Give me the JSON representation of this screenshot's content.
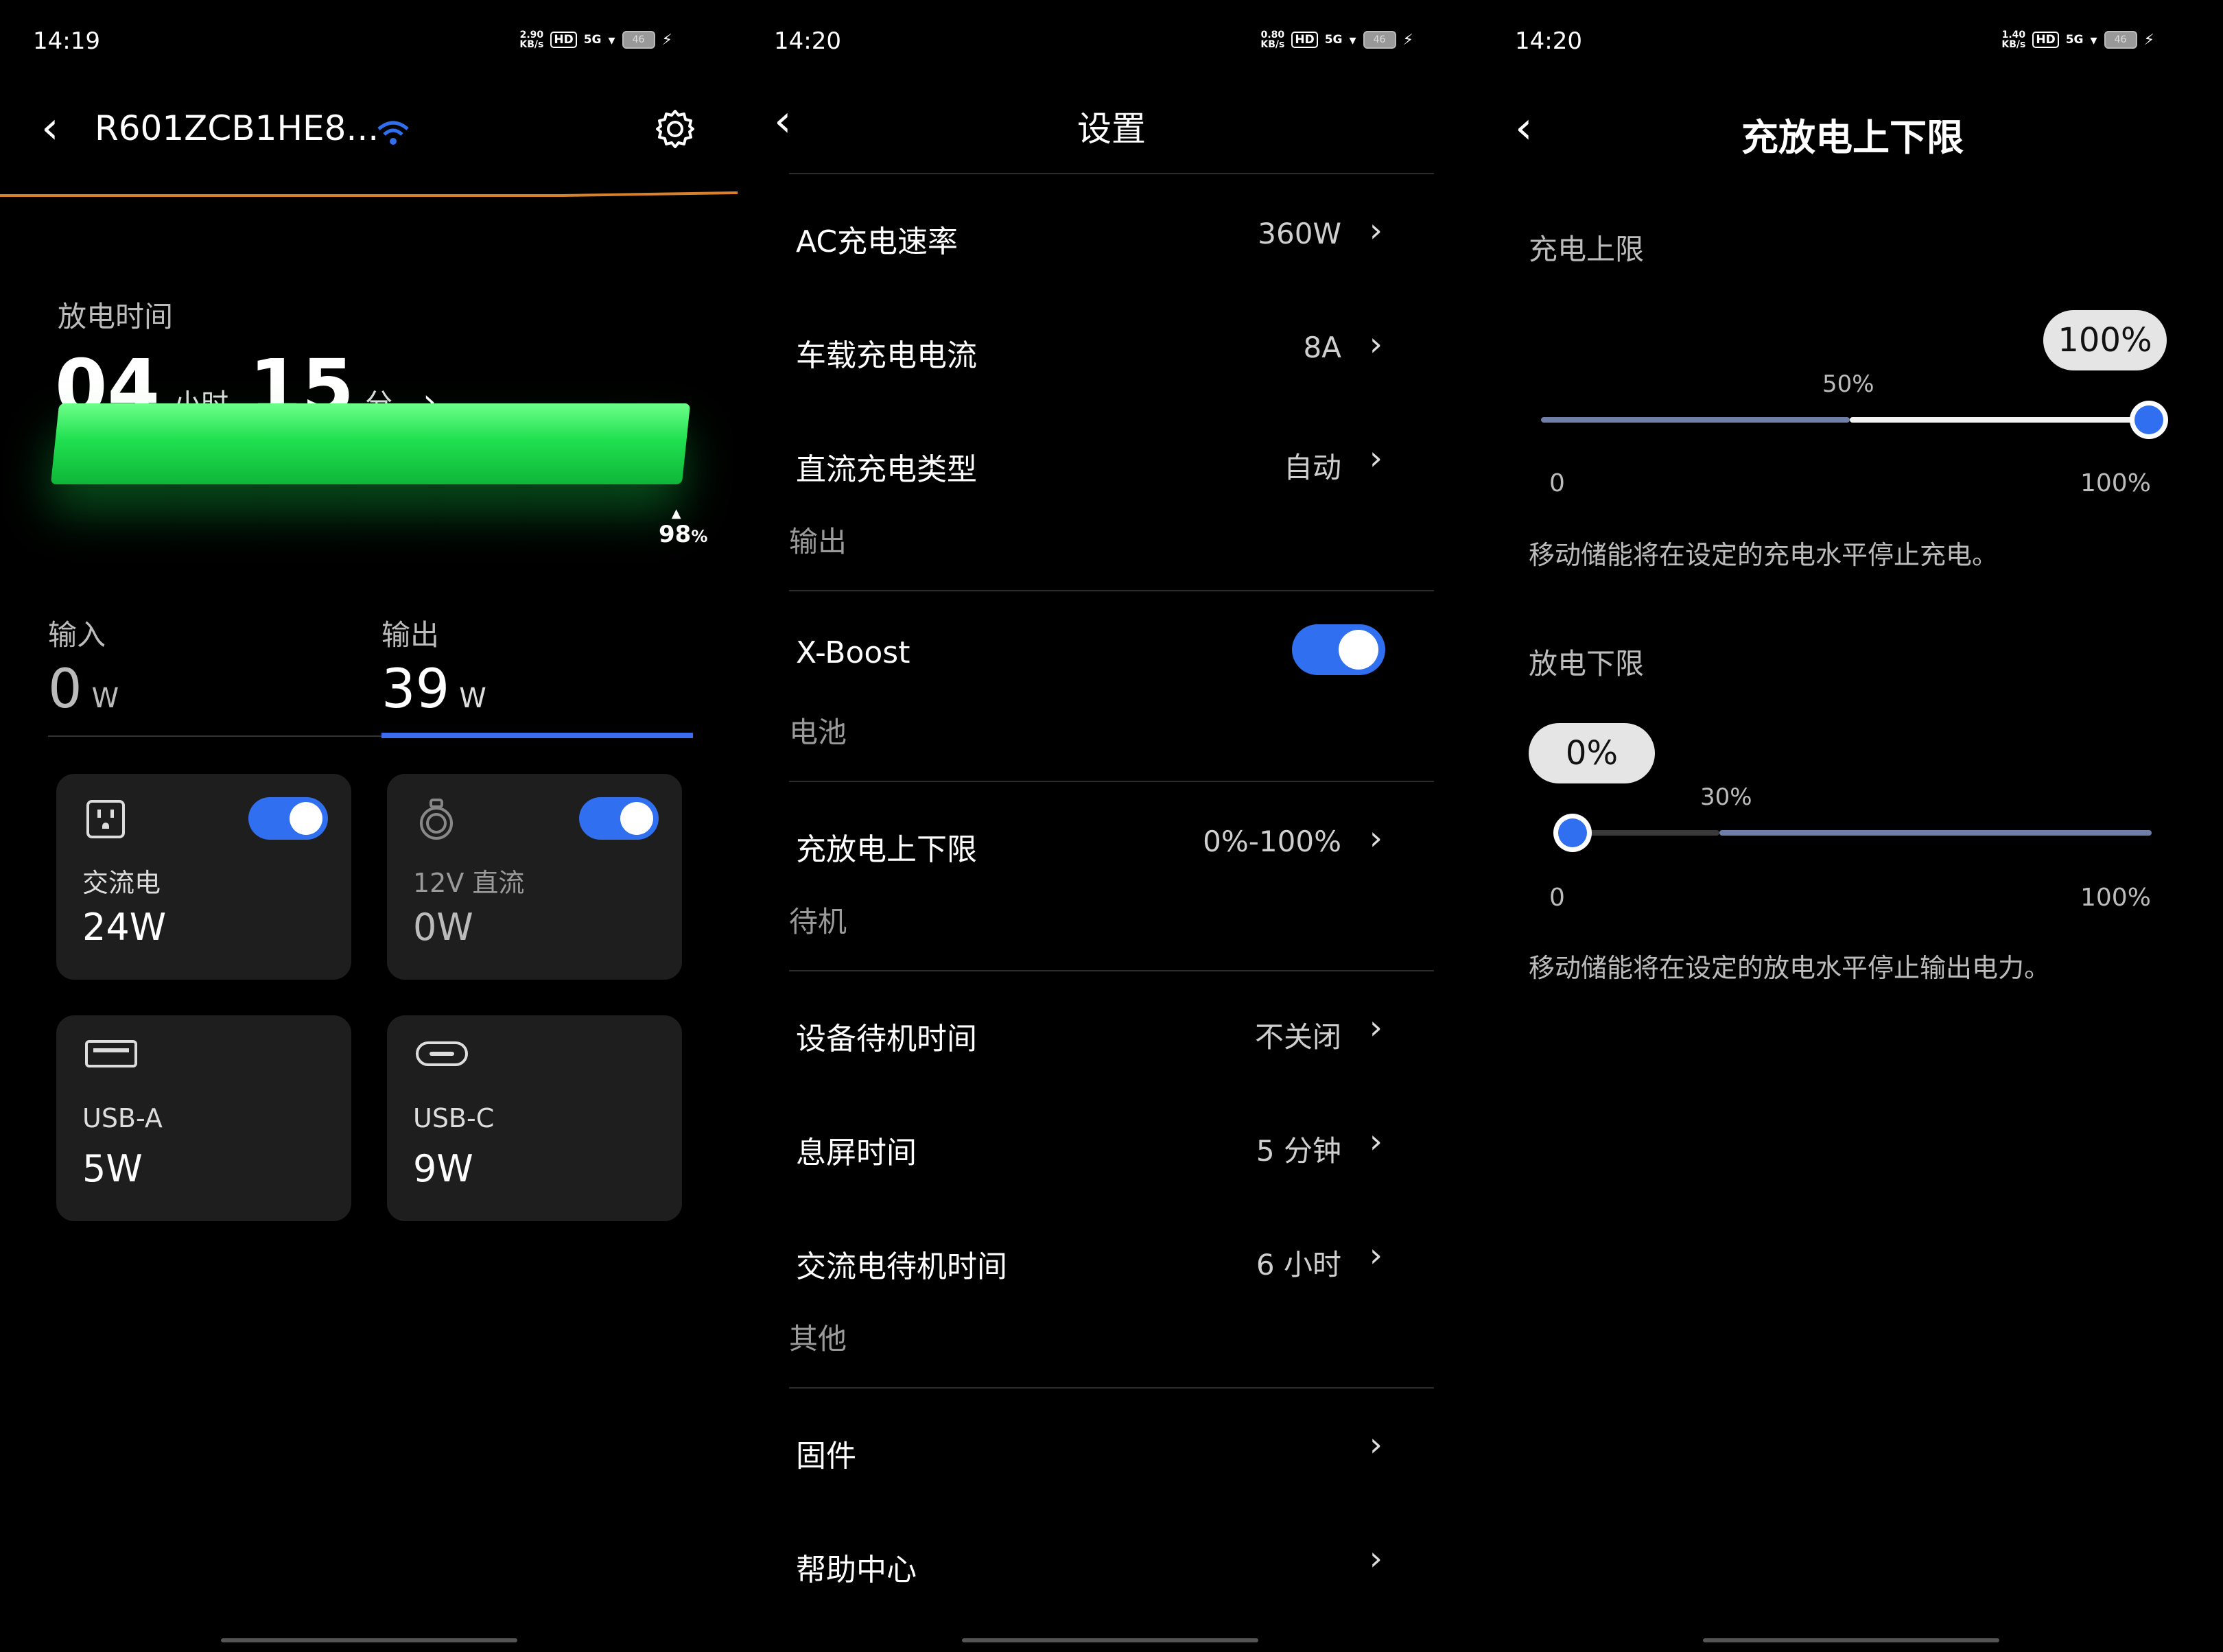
{
  "panel1": {
    "status": {
      "time": "14:19",
      "speed": "2.90\nKB/s",
      "hd": "HD",
      "net": "5G",
      "battery": "46"
    },
    "device_name": "R601ZCB1HE8...",
    "discharge_label": "放电时间",
    "hours": "04",
    "hours_unit": "小时",
    "minutes": "15",
    "minutes_unit": "分",
    "battery_percent": "98",
    "battery_percent_unit": "%",
    "input_label": "输入",
    "input_value": "0",
    "input_unit": "W",
    "output_label": "输出",
    "output_value": "39",
    "output_unit": "W",
    "cards": [
      {
        "label": "交流电",
        "value": "24W",
        "toggle": true
      },
      {
        "label": "12V 直流",
        "value": "0W",
        "toggle": true
      },
      {
        "label": "USB-A",
        "value": "5W"
      },
      {
        "label": "USB-C",
        "value": "9W"
      }
    ]
  },
  "panel2": {
    "status": {
      "time": "14:20",
      "speed": "0.80\nKB/s",
      "hd": "HD",
      "net": "5G",
      "battery": "46"
    },
    "title": "设置",
    "rows": [
      {
        "label": "AC充电速率",
        "value": "360W"
      },
      {
        "label": "车载充电电流",
        "value": "8A"
      },
      {
        "label": "直流充电类型",
        "value": "自动"
      },
      {
        "label": "充放电上下限",
        "value": "0%-100%"
      },
      {
        "label": "设备待机时间",
        "value": "不关闭"
      },
      {
        "label": "息屏时间",
        "value": "5 分钟"
      },
      {
        "label": "交流电待机时间",
        "value": "6 小时"
      },
      {
        "label": "固件",
        "value": ""
      },
      {
        "label": "帮助中心",
        "value": ""
      }
    ],
    "sections": {
      "output": "输出",
      "battery": "电池",
      "standby": "待机",
      "other": "其他"
    },
    "xboost_label": "X-Boost",
    "xboost_on": true
  },
  "panel3": {
    "status": {
      "time": "14:20",
      "speed": "1.40\nKB/s",
      "hd": "HD",
      "net": "5G",
      "battery": "46"
    },
    "title": "充放电上下限",
    "charge_label": "充电上限",
    "charge_value": "100%",
    "charge_marker": "50%",
    "charge_min": "0",
    "charge_max": "100%",
    "charge_desc": "移动储能将在设定的充电水平停止充电。",
    "discharge_label": "放电下限",
    "discharge_value": "0%",
    "discharge_marker": "30%",
    "discharge_min": "0",
    "discharge_max": "100%",
    "discharge_desc": "移动储能将在设定的放电水平停止输出电力。"
  },
  "colors": {
    "accent": "#2f6ff0",
    "green": "#20e050",
    "orange": "#d7822a",
    "card": "#1e1e1e"
  }
}
